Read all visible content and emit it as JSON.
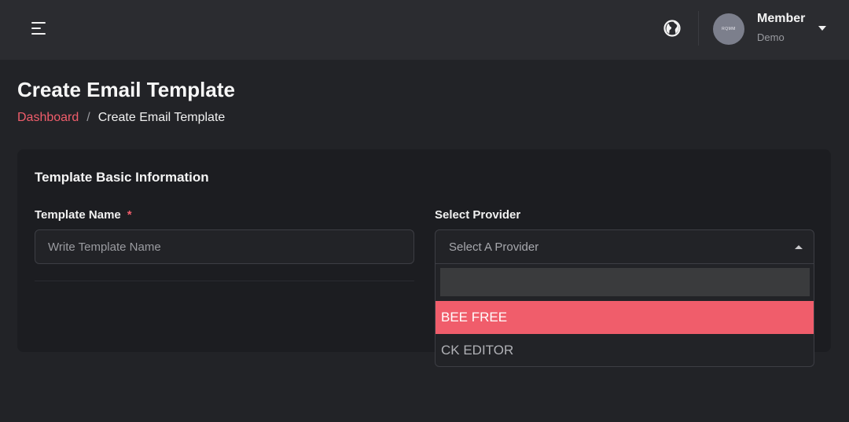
{
  "header": {
    "user_name": "Member",
    "user_role": "Demo",
    "avatar_text": "RQMM"
  },
  "page": {
    "title": "Create Email Template",
    "breadcrumb": {
      "link": "Dashboard",
      "separator": "/",
      "current": "Create Email Template"
    }
  },
  "card": {
    "title": "Template Basic Information",
    "template_name_label": "Template Name",
    "required_mark": "*",
    "template_name_placeholder": "Write Template Name",
    "provider_label": "Select Provider",
    "provider_placeholder": "Select A Provider",
    "provider_options": [
      "BEE FREE",
      "CK EDITOR"
    ]
  },
  "colors": {
    "accent": "#f05d6b",
    "background": "#222327",
    "card": "#1c1d21"
  }
}
